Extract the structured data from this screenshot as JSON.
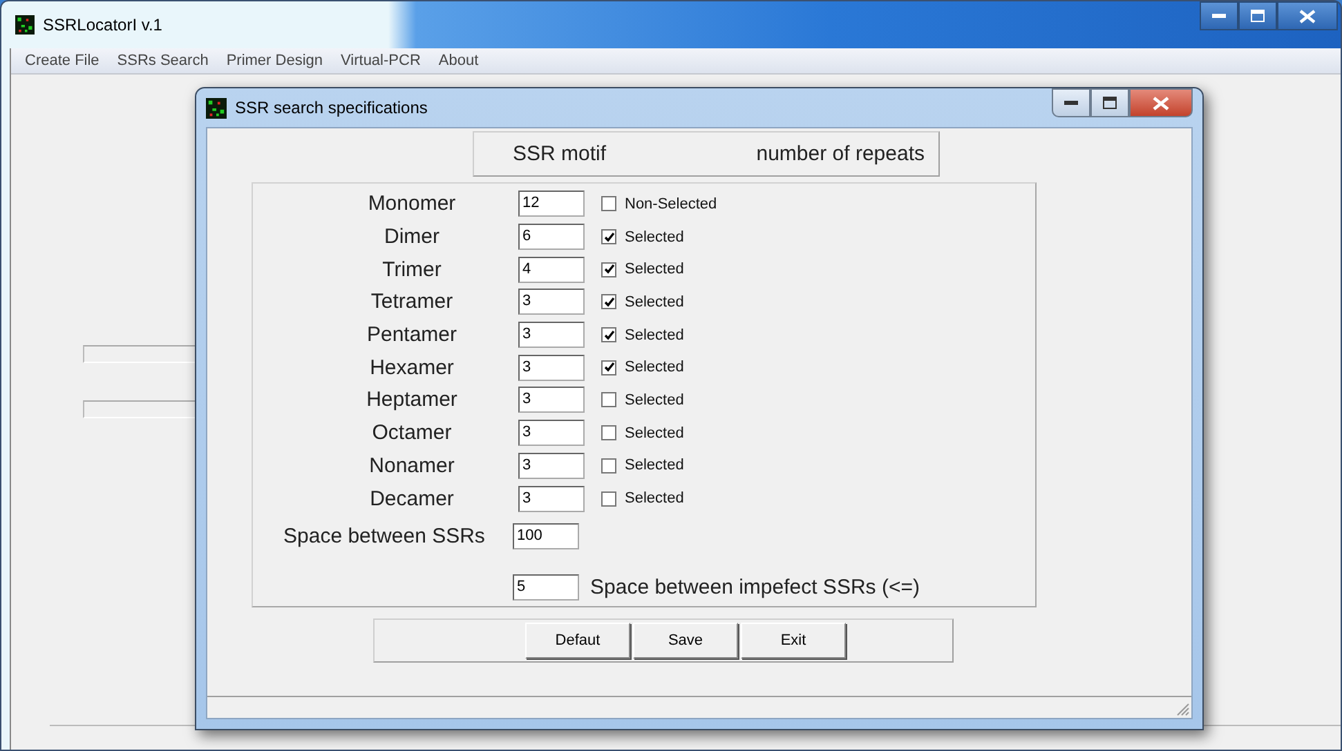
{
  "main_window": {
    "title": "SSRLocatorI v.1",
    "menu": [
      "Create File",
      "SSRs Search",
      "Primer Design",
      "Virtual-PCR",
      "About"
    ]
  },
  "dialog": {
    "title": "SSR search specifications",
    "header": {
      "column_1": "SSR motif",
      "column_2": "number of repeats"
    },
    "motifs": [
      {
        "name": "Monomer",
        "value": "12",
        "checked": false,
        "label": "Non-Selected"
      },
      {
        "name": "Dimer",
        "value": "6",
        "checked": true,
        "label": "Selected"
      },
      {
        "name": "Trimer",
        "value": "4",
        "checked": true,
        "label": "Selected"
      },
      {
        "name": "Tetramer",
        "value": "3",
        "checked": true,
        "label": "Selected"
      },
      {
        "name": "Pentamer",
        "value": "3",
        "checked": true,
        "label": "Selected"
      },
      {
        "name": "Hexamer",
        "value": "3",
        "checked": true,
        "label": "Selected"
      },
      {
        "name": "Heptamer",
        "value": "3",
        "checked": false,
        "label": "Selected"
      },
      {
        "name": "Octamer",
        "value": "3",
        "checked": false,
        "label": "Selected"
      },
      {
        "name": "Nonamer",
        "value": "3",
        "checked": false,
        "label": "Selected"
      },
      {
        "name": "Decamer",
        "value": "3",
        "checked": false,
        "label": "Selected"
      }
    ],
    "space_between_ssrs": {
      "label": "Space between SSRs",
      "value": "100"
    },
    "space_imperfect": {
      "label": "Space between impefect SSRs (<=)",
      "value": "5"
    },
    "buttons": [
      "Defaut",
      "Save",
      "Exit"
    ]
  }
}
